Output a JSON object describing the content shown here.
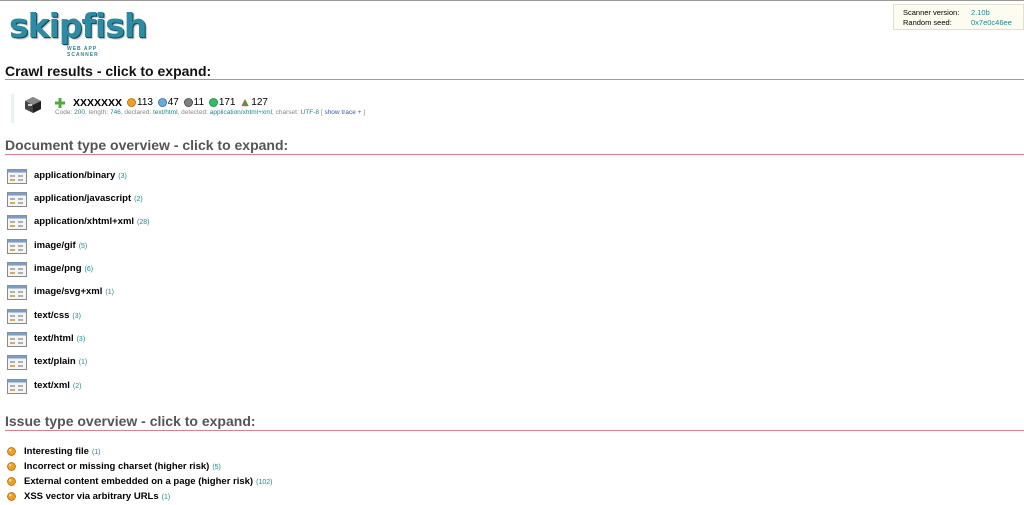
{
  "logo": {
    "word": "skipfish",
    "subtitle": "WEB APP SCANNER"
  },
  "info": {
    "version_label": "Scanner version:",
    "version_value": "2.10b",
    "seed_label": "Random seed:",
    "seed_value": "0x7e0c46ee"
  },
  "crawl": {
    "title": "Crawl results - click to expand:",
    "host": "XXXXXXX",
    "counts": [
      {
        "value": "113",
        "color": "#f0a020",
        "icon": "high-risk-icon"
      },
      {
        "value": "47",
        "color": "#6aa8e0",
        "icon": "low-risk-icon"
      },
      {
        "value": "11",
        "color": "#808080",
        "icon": "info-icon"
      },
      {
        "value": "171",
        "color": "#30c060",
        "icon": "note-icon"
      },
      {
        "value": "127",
        "color": "#c06040",
        "icon": "node-icon"
      }
    ],
    "meta": {
      "code_label": "Code: ",
      "code": "200",
      "length_label": ", length: ",
      "length": "746",
      "declared_label": ", declared: ",
      "declared": "text/html",
      "detected_label": ", detected: ",
      "detected": "application/xhtml+xml",
      "charset_label": ", charset: ",
      "charset": "UTF-8",
      "trace_open": " [ ",
      "trace": "show trace +",
      "trace_close": " ]"
    }
  },
  "doctypes": {
    "title": "Document type overview - click to expand:",
    "items": [
      {
        "label": "application/binary",
        "count": "(3)"
      },
      {
        "label": "application/javascript",
        "count": "(2)"
      },
      {
        "label": "application/xhtml+xml",
        "count": "(28)"
      },
      {
        "label": "image/gif",
        "count": "(5)"
      },
      {
        "label": "image/png",
        "count": "(6)"
      },
      {
        "label": "image/svg+xml",
        "count": "(1)"
      },
      {
        "label": "text/css",
        "count": "(3)"
      },
      {
        "label": "text/html",
        "count": "(3)"
      },
      {
        "label": "text/plain",
        "count": "(1)"
      },
      {
        "label": "text/xml",
        "count": "(2)"
      }
    ]
  },
  "issues": {
    "title": "Issue type overview - click to expand:",
    "items": [
      {
        "label": "Interesting file",
        "count": "(1)"
      },
      {
        "label": "Incorrect or missing charset (higher risk)",
        "count": "(5)"
      },
      {
        "label": "External content embedded on a page (higher risk)",
        "count": "(102)"
      },
      {
        "label": "XSS vector via arbitrary URLs",
        "count": "(1)"
      }
    ]
  },
  "colors": {
    "accent": "#1a8a94",
    "rule": "#d98090",
    "warning": "#f0a020"
  }
}
